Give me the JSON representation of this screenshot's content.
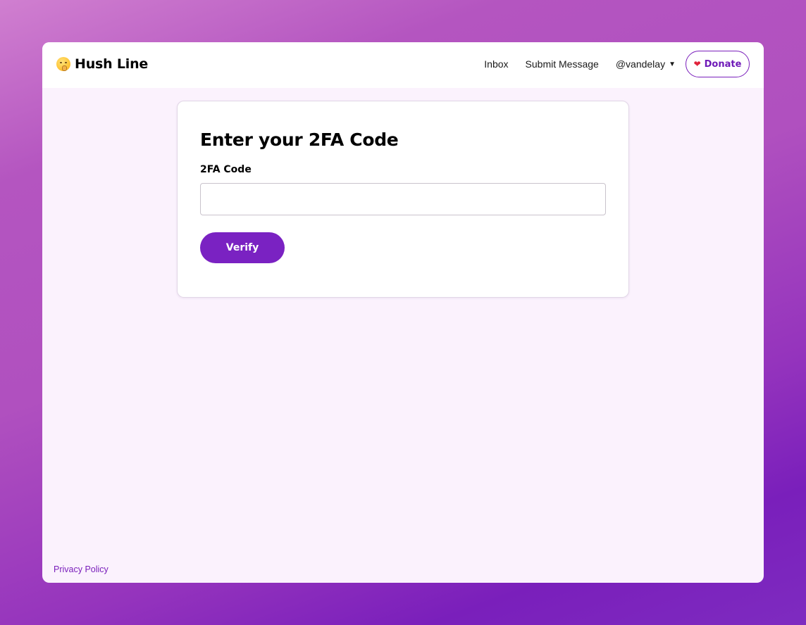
{
  "header": {
    "brand_name": "Hush Line",
    "brand_icon": "shushing-face-icon",
    "nav": {
      "inbox_label": "Inbox",
      "submit_label": "Submit Message",
      "user_label": "@vandelay",
      "user_caret": "▼",
      "donate_label": "Donate",
      "donate_icon": "heart-icon"
    }
  },
  "main": {
    "title": "Enter your 2FA Code",
    "field_label": "2FA Code",
    "field_value": "",
    "verify_label": "Verify"
  },
  "footer": {
    "privacy_label": "Privacy Policy"
  },
  "colors": {
    "accent": "#7a22c2",
    "page_background": "#fbf2fd",
    "outer_gradient_start": "#d07fd0",
    "outer_gradient_end": "#7a1fbb"
  }
}
